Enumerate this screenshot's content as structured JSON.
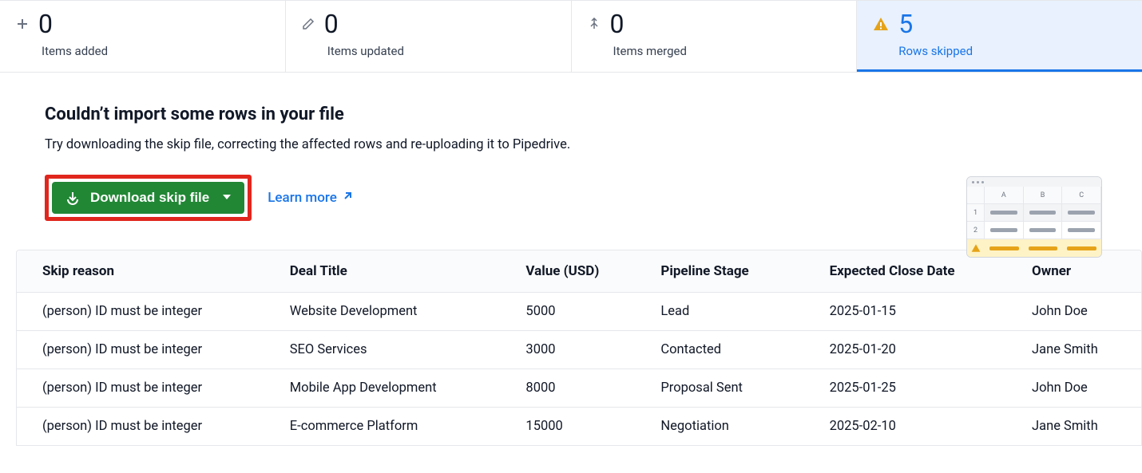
{
  "summary": {
    "tabs": [
      {
        "count": "0",
        "label": "Items added",
        "icon": "plus"
      },
      {
        "count": "0",
        "label": "Items updated",
        "icon": "pencil"
      },
      {
        "count": "0",
        "label": "Items merged",
        "icon": "merge"
      },
      {
        "count": "5",
        "label": "Rows skipped",
        "icon": "warning",
        "active": true
      }
    ]
  },
  "message": {
    "heading": "Couldn’t import some rows in your file",
    "subheading": "Try downloading the skip file, correcting the affected rows and re-uploading it to Pipedrive.",
    "download_label": "Download skip file",
    "learn_more_label": "Learn more"
  },
  "illustration": {
    "cols": [
      "A",
      "B",
      "C"
    ],
    "rows": [
      "1",
      "2"
    ]
  },
  "table": {
    "columns": [
      "Skip reason",
      "Deal Title",
      "Value (USD)",
      "Pipeline Stage",
      "Expected Close Date",
      "Owner"
    ],
    "rows": [
      {
        "reason": "(person) ID must be integer",
        "title": "Website Development",
        "value": "5000",
        "stage": "Lead",
        "date": "2025-01-15",
        "owner": "John Doe"
      },
      {
        "reason": "(person) ID must be integer",
        "title": "SEO Services",
        "value": "3000",
        "stage": "Contacted",
        "date": "2025-01-20",
        "owner": "Jane Smith"
      },
      {
        "reason": "(person) ID must be integer",
        "title": "Mobile App Development",
        "value": "8000",
        "stage": "Proposal Sent",
        "date": "2025-01-25",
        "owner": "John Doe"
      },
      {
        "reason": "(person) ID must be integer",
        "title": "E-commerce Platform",
        "value": "15000",
        "stage": "Negotiation",
        "date": "2025-02-10",
        "owner": "Jane Smith"
      }
    ]
  }
}
